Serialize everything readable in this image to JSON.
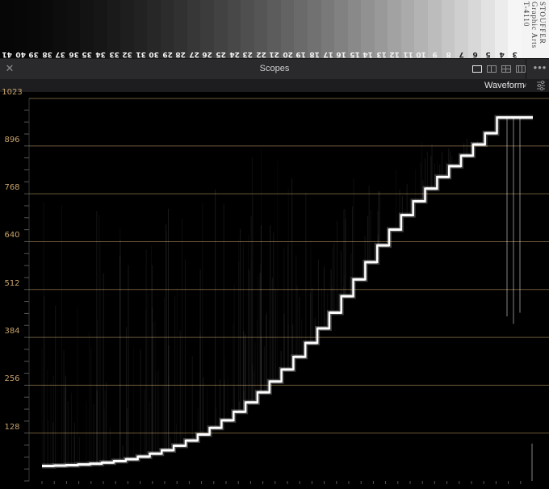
{
  "wedge": {
    "steps": [
      "41",
      "40",
      "39",
      "38",
      "37",
      "36",
      "35",
      "34",
      "33",
      "32",
      "31",
      "30",
      "29",
      "28",
      "27",
      "26",
      "25",
      "24",
      "23",
      "22",
      "21",
      "20",
      "19",
      "18",
      "17",
      "16",
      "15",
      "14",
      "13",
      "12",
      "11",
      "10",
      "9",
      "8",
      "7",
      "6",
      "5",
      "4",
      "3"
    ],
    "label_lines": [
      "STOUFFER",
      "Graphic Arts",
      "T-4110"
    ]
  },
  "panel": {
    "title": "Scopes",
    "close_icon": "close-icon",
    "layout_icons": [
      "single-layout-icon",
      "dual-layout-icon",
      "quad-layout-icon",
      "grid-layout-icon"
    ],
    "more_icon": "more-options-icon"
  },
  "toolbar": {
    "scope_type": "Waveform",
    "settings_icon": "scope-settings-icon"
  },
  "scope": {
    "y_axis_labels": [
      "1023",
      "896",
      "768",
      "640",
      "512",
      "384",
      "256",
      "128",
      "0"
    ],
    "grid_color": "#c8a36a",
    "trace_color": "#ffffff"
  },
  "chart_data": {
    "type": "line",
    "title": "",
    "xlabel": "",
    "ylabel": "",
    "ylim": [
      0,
      1023
    ],
    "y_ticks": [
      0,
      128,
      256,
      384,
      512,
      640,
      768,
      896,
      1023
    ],
    "series": [
      {
        "values": [
          40,
          41,
          42,
          44,
          46,
          49,
          53,
          58,
          65,
          73,
          82,
          94,
          108,
          124,
          142,
          162,
          185,
          210,
          237,
          266,
          298,
          332,
          369,
          408,
          450,
          494,
          539,
          585,
          630,
          672,
          711,
          748,
          782,
          813,
          842,
          870,
          900,
          930,
          972,
          972,
          972
        ]
      }
    ]
  }
}
